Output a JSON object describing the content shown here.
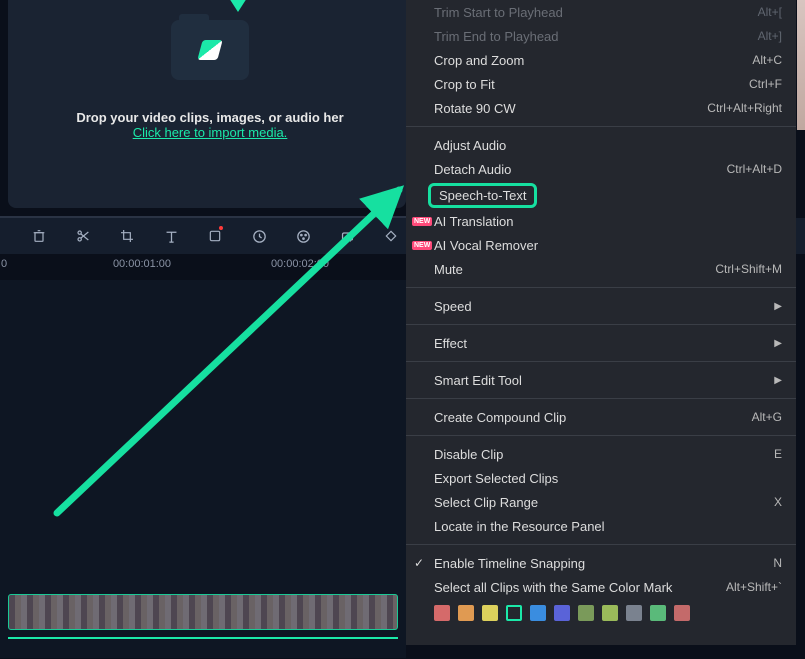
{
  "drop_zone": {
    "text": "Drop your video clips, images, or audio her",
    "link": "Click here to import media."
  },
  "timeline": {
    "ticks": [
      "0",
      "00:00:01:00",
      "00:00:02:00"
    ]
  },
  "context_menu": {
    "trim_start": "Trim Start to Playhead",
    "trim_start_sc": "Alt+[",
    "trim_end": "Trim End to Playhead",
    "trim_end_sc": "Alt+]",
    "crop_zoom": "Crop and Zoom",
    "crop_zoom_sc": "Alt+C",
    "crop_fit": "Crop to Fit",
    "crop_fit_sc": "Ctrl+F",
    "rotate": "Rotate 90 CW",
    "rotate_sc": "Ctrl+Alt+Right",
    "adjust_audio": "Adjust Audio",
    "detach_audio": "Detach Audio",
    "detach_audio_sc": "Ctrl+Alt+D",
    "speech_text": "Speech-to-Text",
    "ai_translation": "AI Translation",
    "ai_vocal": "AI Vocal Remover",
    "mute": "Mute",
    "mute_sc": "Ctrl+Shift+M",
    "speed": "Speed",
    "effect": "Effect",
    "smart_edit": "Smart Edit Tool",
    "compound": "Create Compound Clip",
    "compound_sc": "Alt+G",
    "disable": "Disable Clip",
    "disable_sc": "E",
    "export_sel": "Export Selected Clips",
    "select_range": "Select Clip Range",
    "select_range_sc": "X",
    "locate": "Locate in the Resource Panel",
    "snapping": "Enable Timeline Snapping",
    "snapping_sc": "N",
    "select_all_color": "Select all Clips with the Same Color Mark",
    "select_all_color_sc": "Alt+Shift+`",
    "new_badge": "NEW"
  },
  "colors": [
    "#d56a6a",
    "#e09a52",
    "#dcd05c",
    "#1be9a9",
    "#3a8de0",
    "#5a63d8",
    "#7a9a5a",
    "#9aba5a",
    "#7a828f",
    "#5aba7a",
    "#c46a6a"
  ]
}
